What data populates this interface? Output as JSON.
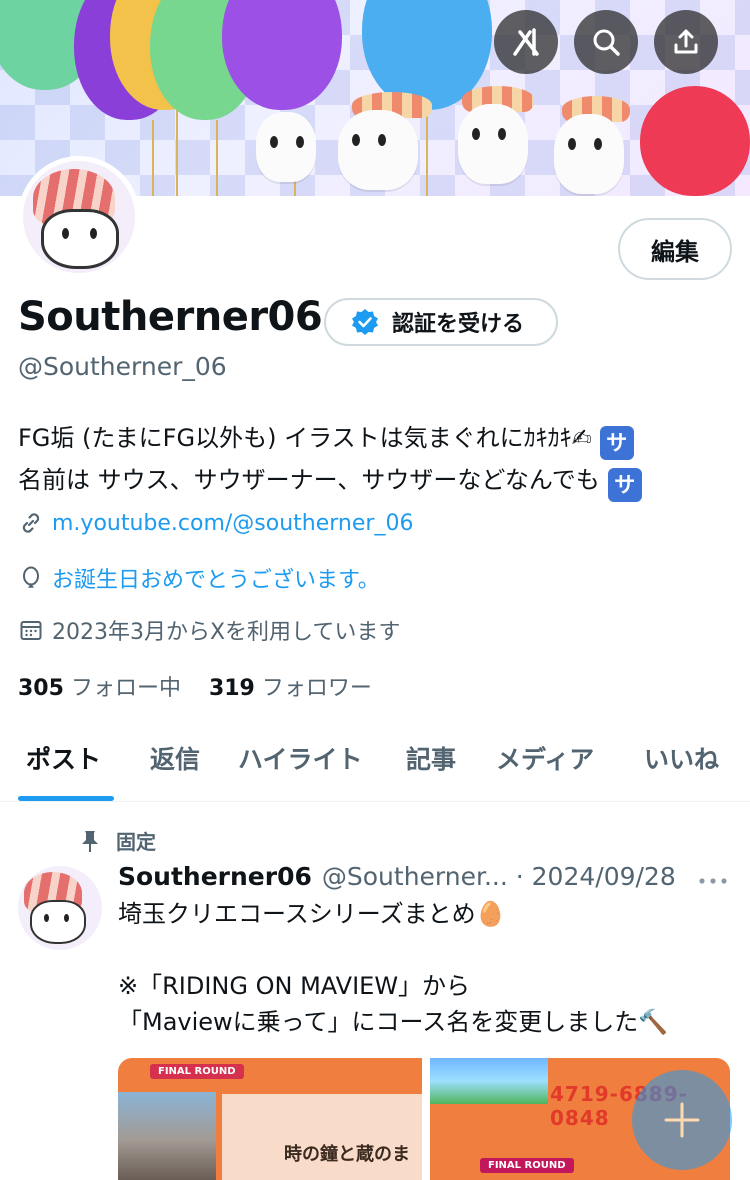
{
  "banner": {
    "buttons": [
      {
        "name": "grok-icon"
      },
      {
        "name": "search-icon"
      },
      {
        "name": "share-icon"
      }
    ]
  },
  "profile": {
    "edit_label": "編集",
    "display_name": "Southerner06",
    "verify_label": "認証を受ける",
    "handle": "@Southerner_06",
    "bio_line1": "FG垢 (たまにFG以外も) イラストは気まぐれにｶｷｶｷ",
    "bio_line1_emoji": "✍",
    "bio_badge": "サ",
    "bio_line2": "名前は サウス、サウザーナー、サウザーなどなんでも",
    "website": "m.youtube.com/@southerner_06",
    "birthday": "お誕生日おめでとうございます。",
    "joined": "2023年3月からXを利用しています",
    "following_count": "305",
    "following_label": "フォロー中",
    "followers_count": "319",
    "followers_label": "フォロワー"
  },
  "tabs": [
    {
      "label": "ポスト",
      "active": true
    },
    {
      "label": "返信"
    },
    {
      "label": "ハイライト"
    },
    {
      "label": "記事"
    },
    {
      "label": "メディア"
    },
    {
      "label": "いいね"
    }
  ],
  "pinned_post": {
    "pinned_label": "固定",
    "author_name": "Southerner06",
    "author_handle": "@Southerner... · 2024/09/28",
    "more": "•••",
    "text": "埼玉クリエコースシリーズまとめ🥚\n\n※「RIDING ON MAVIEW」から\n「Maviewに乗って」にコース名を変更しました🔨",
    "media": [
      {
        "tag": "FINAL ROUND",
        "title": "時の鐘と蔵のま"
      },
      {
        "tag": "FINAL ROUND",
        "code": "4719-6889-0848"
      }
    ]
  },
  "colors": {
    "accent": "#1d9bf0",
    "secondary_text": "#536471"
  }
}
